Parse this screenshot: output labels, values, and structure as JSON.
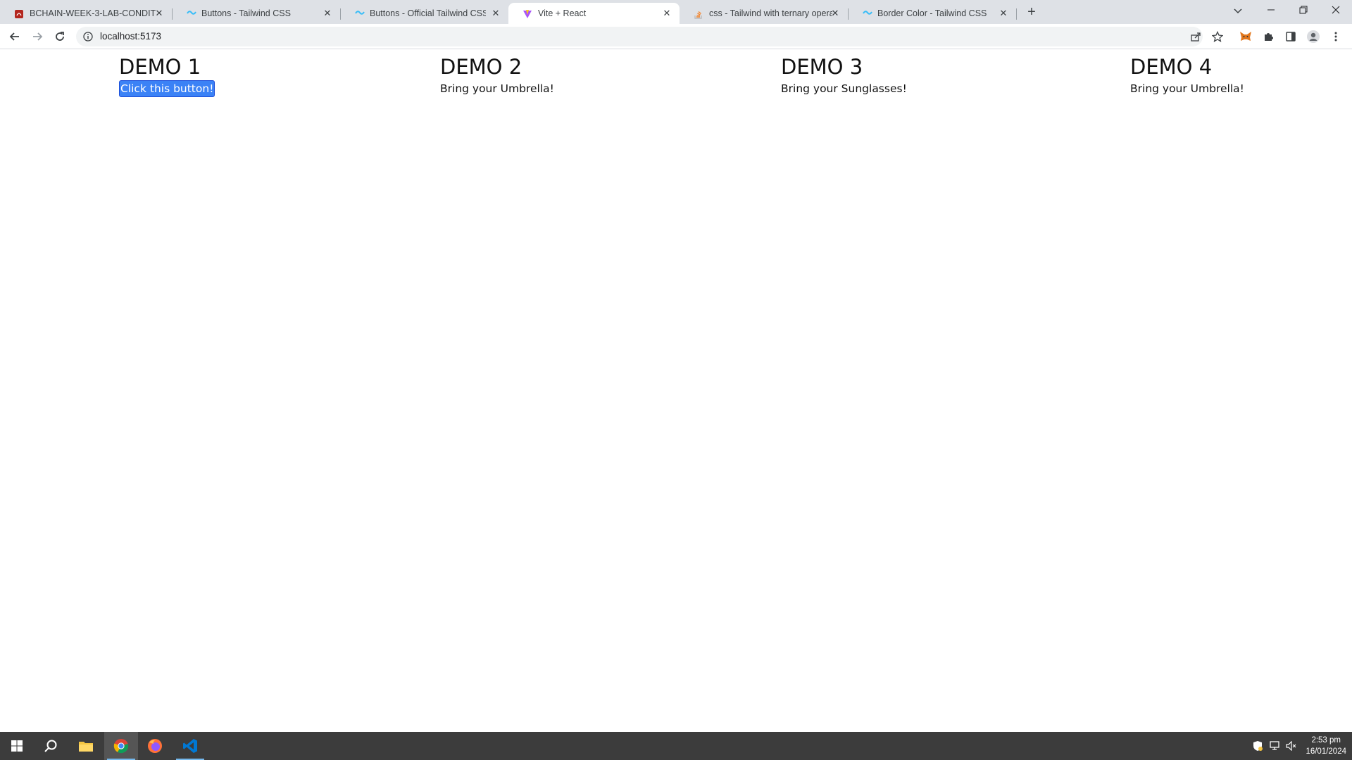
{
  "browser": {
    "tabs": [
      {
        "title": "BCHAIN-WEEK-3-LAB-CONDITIO",
        "favicon": "pdf-icon"
      },
      {
        "title": "Buttons - Tailwind CSS",
        "favicon": "tailwind-icon"
      },
      {
        "title": "Buttons - Official Tailwind CSS UI",
        "favicon": "tailwind-icon"
      },
      {
        "title": "Vite + React",
        "favicon": "vite-icon",
        "active": true
      },
      {
        "title": "css - Tailwind with ternary operat",
        "favicon": "stackoverflow-icon"
      },
      {
        "title": "Border Color - Tailwind CSS",
        "favicon": "tailwind-icon"
      }
    ],
    "url": "localhost:5173"
  },
  "page": {
    "demos": [
      {
        "heading": "DEMO 1",
        "button_label": "Click this button!"
      },
      {
        "heading": "DEMO 2",
        "message": "Bring your Umbrella!"
      },
      {
        "heading": "DEMO 3",
        "message": "Bring your Sunglasses!"
      },
      {
        "heading": "DEMO 4",
        "message": "Bring your Umbrella!"
      }
    ]
  },
  "taskbar": {
    "apps": [
      "windows-start-icon",
      "search-icon",
      "file-explorer-icon",
      "chrome-icon",
      "firefox-icon",
      "vscode-icon"
    ],
    "clock": {
      "time": "2:53 pm",
      "date": "16/01/2024"
    }
  },
  "colors": {
    "button_bg": "#3b82f6",
    "tab_strip": "#dee1e6",
    "taskbar": "#3c3c3c"
  }
}
